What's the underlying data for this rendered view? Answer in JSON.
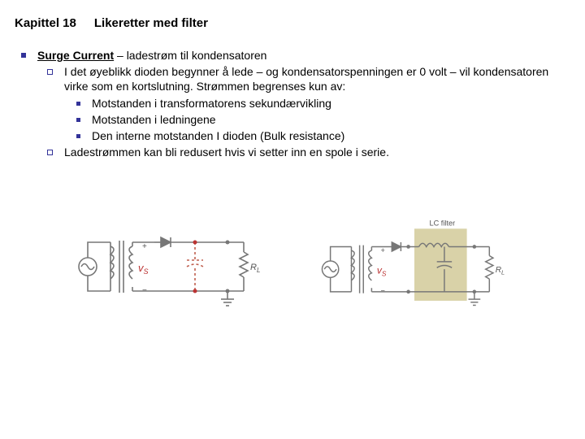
{
  "chapter": "Kapittel 18",
  "title": "Likeretter med filter",
  "heading_term": "Surge Current",
  "heading_rest": " – ladestrøm til kondensatoren",
  "sub1": "I det øyeblikk dioden begynner å lede – og kondensatorspenningen er 0 volt – vil kondensatoren virke som en kortslutning. Strømmen begrenses kun av:",
  "p1": "Motstanden i transformatorens sekundærvikling",
  "p2": "Motstanden i ledningene",
  "p3": "Den interne motstanden I dioden (Bulk resistance)",
  "sub2": "Ladestrømmen kan bli redusert hvis vi setter inn en spole i serie.",
  "fig": {
    "vs": "v",
    "vs_sub": "S",
    "rl": "R",
    "rl_sub": "L",
    "lc_label": "LC filter"
  }
}
